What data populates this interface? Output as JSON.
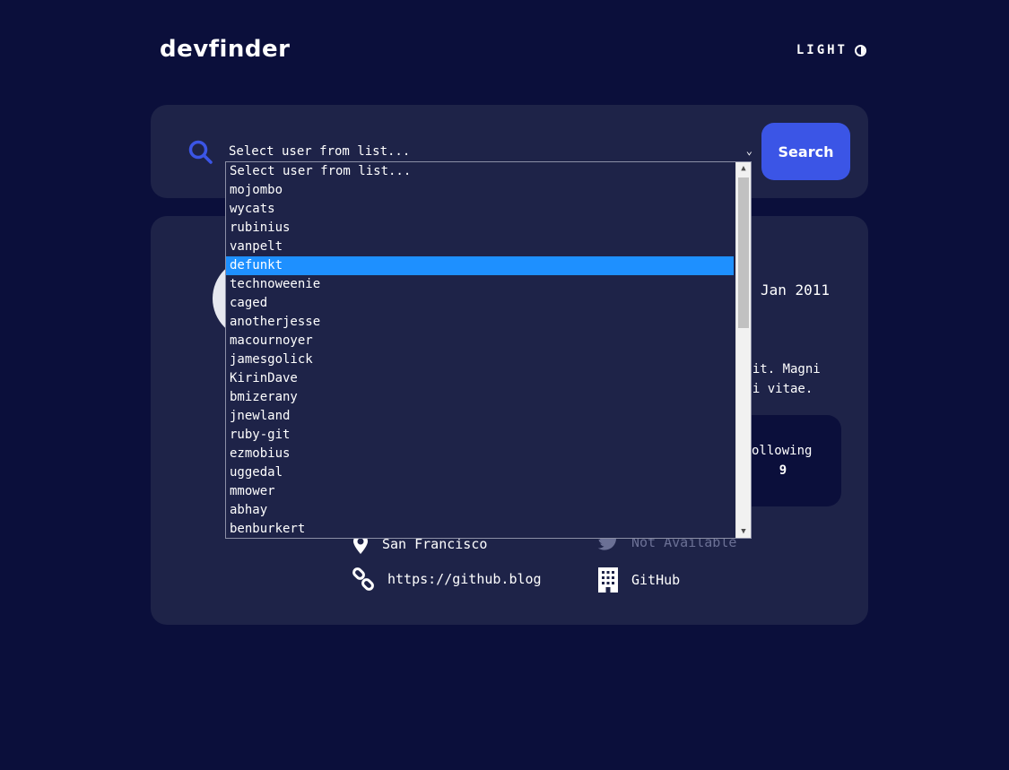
{
  "header": {
    "logo": "devfinder",
    "theme_label": "LIGHT"
  },
  "search": {
    "selected": "Select user from list...",
    "button_label": "Search",
    "options": [
      "Select user from list...",
      "mojombo",
      "wycats",
      "rubinius",
      "vanpelt",
      "defunkt",
      "technoweenie",
      "caged",
      "anotherjesse",
      "macournoyer",
      "jamesgolick",
      "KirinDave",
      "bmizerany",
      "jnewland",
      "ruby-git",
      "ezmobius",
      "uggedal",
      "mmower",
      "abhay",
      "benburkert"
    ],
    "highlighted": "defunkt"
  },
  "profile": {
    "joined_fragment": "Jan 2011",
    "bio_line1": "elit. Magni",
    "bio_line2": "odi vitae.",
    "following_label_fragment": "ollowing",
    "following_value": "9",
    "location": "San Francisco",
    "twitter": "Not Available",
    "blog": "https://github.blog",
    "company": "GitHub"
  },
  "colors": {
    "background": "#0b0f3b",
    "card": "#1e2348",
    "accent": "#3b55e6",
    "highlight": "#1e90ff"
  }
}
